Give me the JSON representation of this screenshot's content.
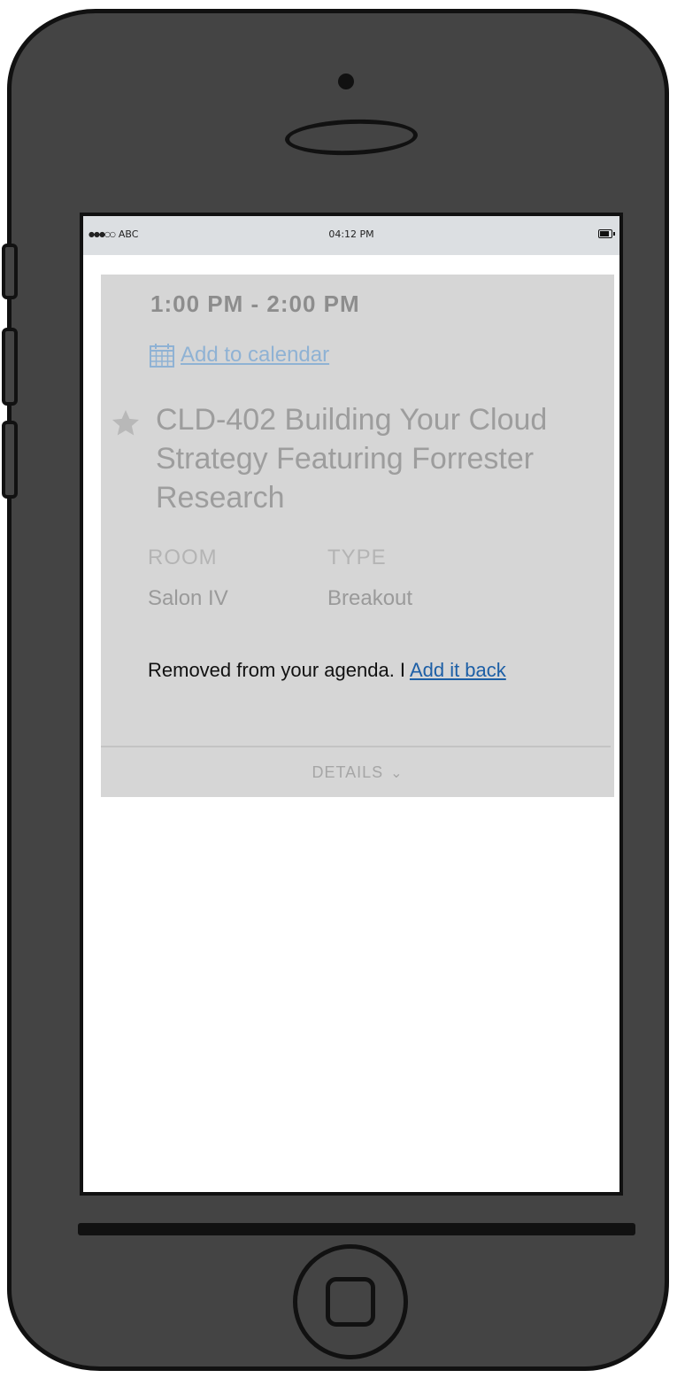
{
  "status_bar": {
    "carrier": "ABC",
    "time": "04:12 PM",
    "icons": [
      "signal-dots-icon",
      "battery-icon"
    ]
  },
  "session": {
    "time_range": "1:00 PM - 2:00 PM",
    "add_to_calendar": "Add to calendar",
    "title": "CLD-402 Building Your Cloud Strategy Featuring Forrester Research",
    "room_label": "ROOM",
    "room_value": "Salon IV",
    "type_label": "TYPE",
    "type_value": "Breakout",
    "removed_text": "Removed from your agenda. I ",
    "add_back_link": "Add it back",
    "details_label": "DETAILS",
    "icons": [
      "calendar-icon",
      "star-icon",
      "chevron-down-icon"
    ]
  },
  "colors": {
    "card_bg": "#d6d6d6",
    "link": "#1d5fa6",
    "phone_body": "#444444"
  }
}
